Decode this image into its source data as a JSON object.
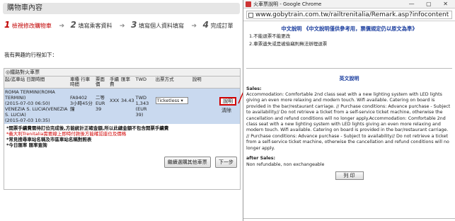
{
  "cart": {
    "title": "購物車內容",
    "steps": [
      {
        "num": "1",
        "label": "檢視修改購物車"
      },
      {
        "num": "2",
        "label": "填寫乘客資料"
      },
      {
        "num": "3",
        "label": "填寫個人資料填寫"
      },
      {
        "num": "4",
        "label": "完成訂單"
      }
    ],
    "trip_label": "我有興趣的行程如下：",
    "panel_title": "◎鐵路對火車票",
    "table_headers": [
      "起/迄車站\n日期時間",
      "車種\n行車時間",
      "票面價",
      "手續費",
      "匯率",
      "TWD",
      "出票方式",
      "說明"
    ],
    "row": {
      "from": "ROMA TERMINI(ROMA TERMINI)",
      "from_time": "(2015-07-03 06:50)",
      "to": "VENEZIA S. LUCIA(VENEZIA S. LUCIA)",
      "to_time": "(2015-07-03 10:35)",
      "train": "FA9402",
      "duration": "3小時45分鐘",
      "face": "二等 EUR 39",
      "fee": "XXX",
      "rate": "34.43",
      "twd": "TWD 1,343 (EUR 39)",
      "issue": "Ticketless"
    },
    "explain_btn": "說明",
    "clear_btn": "清除",
    "notes": [
      {
        "text": "*開票手續費需待訂位完成後,方能統計正確金額,所以此總金額不包含開票手續費",
        "style": "bold"
      },
      {
        "text": "*義大利Trenitalia需要線上即時付款後方能確認座位及價格",
        "style": "red"
      },
      {
        "text": "*常見搜尋車站名稱及市區車站名稱對照表",
        "style": "bold"
      },
      {
        "text": "*今日匯率   匯率查詢",
        "style": "bold"
      }
    ],
    "continue_btn": "繼續選購其他車票",
    "next_btn": "下一步"
  },
  "popup": {
    "window_title": "火車票說明 - Google Chrome",
    "window_controls": "— ▢ ✕",
    "url": "www.gobytrain.com.tw/railtrenitalia/Remark.asp?infocontent",
    "zh_heading": "中文說明 《中文說明僅供參考用，票價規定仍以原文為準》",
    "zh_items": [
      "1.不能退票不能更改",
      "2.車票遺失或是被偷竊則無法辦理退票"
    ],
    "en_heading": "英文說明",
    "sales_label": "Sales:",
    "sales_text": "Accommodation: Comfortable 2nd class seat with a new lighting system with LED lights giving an even more relaxing and modern touch. Wifi available. Catering on board is provided in the bar/restaurant carriage. // Purchase conditions: Advance purchase - Subject to availability// Do not retrieve a ticket from a self-service ticket machine, otherwise the cancellation and refund conditions will no longer apply.Accommodation: Comfortable 2nd class seat with a new lighting system with LED lights giving an even more relaxing and modern touch. Wifi available. Catering on board is provided in the bar/restaurant carriage. // Purchase conditions: Advance purchase - Subject to availability// Do not retrieve a ticket from a self-service ticket machine, otherwise the cancellation and refund conditions will no longer apply.",
    "after_label": "after Sales:",
    "after_text": "Non refundable, non exchangeable",
    "print_btn": "列 印"
  },
  "colors": {
    "highlight_red": "#d00000",
    "row_blue": "#c9d9ef",
    "link_blue": "#1a3d9e"
  }
}
